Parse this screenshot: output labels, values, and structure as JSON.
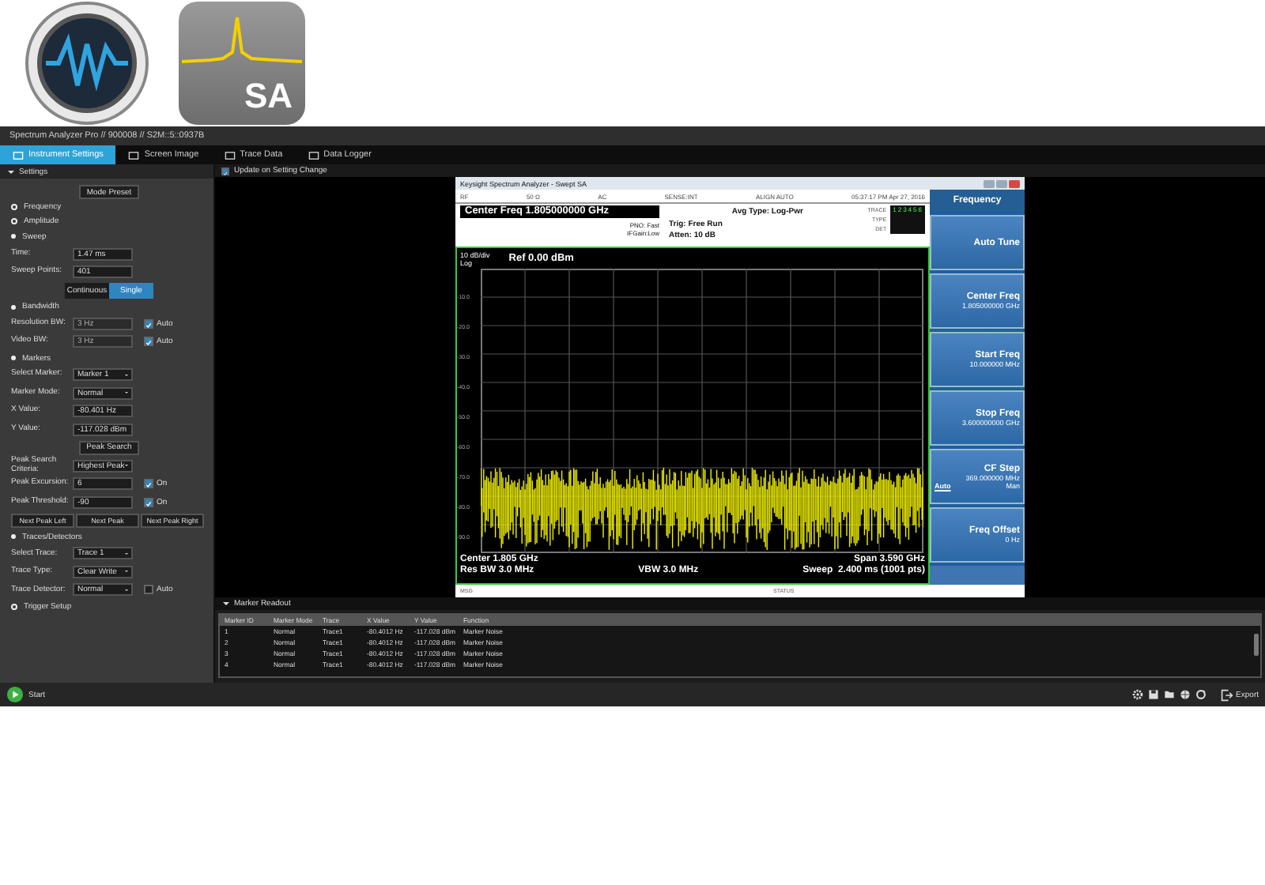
{
  "launcher": {
    "sa_label": "SA"
  },
  "window": {
    "title": "Spectrum Analyzer Pro // 900008 // S2M::5::0937B"
  },
  "tabs": [
    {
      "label": "Instrument Settings",
      "selected": true
    },
    {
      "label": "Screen Image",
      "selected": false
    },
    {
      "label": "Trace Data",
      "selected": false
    },
    {
      "label": "Data Logger",
      "selected": false
    }
  ],
  "settings": {
    "title": "Settings",
    "expanded": true,
    "preset_button": "Mode Preset",
    "sections": [
      {
        "title": "Frequency",
        "expanded": false
      },
      {
        "title": "Amplitude",
        "expanded": false
      },
      {
        "title": "Sweep",
        "expanded": true,
        "rows": [
          {
            "kind": "field",
            "label": "Time:",
            "value": "1.47 ms",
            "disabled": false
          },
          {
            "kind": "field",
            "label": "Sweep Points:",
            "value": "401",
            "disabled": false
          },
          {
            "kind": "segmented",
            "options": [
              {
                "label": "Continuous",
                "selected": false
              },
              {
                "label": "Single",
                "selected": true
              }
            ]
          }
        ]
      },
      {
        "title": "Bandwidth",
        "expanded": true,
        "rows": [
          {
            "kind": "field",
            "label": "Resolution BW:",
            "value": "3 Hz",
            "disabled": true,
            "check": {
              "label": "Auto",
              "checked": true
            }
          },
          {
            "kind": "field",
            "label": "Video BW:",
            "value": "3 Hz",
            "disabled": true,
            "check": {
              "label": "Auto",
              "checked": true
            }
          }
        ]
      },
      {
        "title": "Markers",
        "expanded": true,
        "rows": [
          {
            "kind": "dropdown",
            "label": "Select Marker:",
            "value": "Marker 1"
          },
          {
            "kind": "dropdown",
            "label": "Marker Mode:",
            "value": "Normal"
          },
          {
            "kind": "field",
            "label": "X Value:",
            "value": "-80.401 Hz",
            "disabled": false
          },
          {
            "kind": "field",
            "label": "Y Value:",
            "value": "-117.028 dBm",
            "disabled": false
          },
          {
            "kind": "button",
            "label": "Peak Search"
          },
          {
            "kind": "dropdown",
            "label": "Peak Search Criteria:",
            "value": "Highest Peak"
          },
          {
            "kind": "field",
            "label": "Peak Excursion:",
            "value": "6",
            "disabled": false,
            "check": {
              "label": "On",
              "checked": true
            }
          },
          {
            "kind": "field",
            "label": "Peak Threshold:",
            "value": "-90",
            "disabled": false,
            "check": {
              "label": "On",
              "checked": true
            }
          },
          {
            "kind": "buttons",
            "buttons": [
              "Next Peak Left",
              "Next Peak",
              "Next Peak Right"
            ]
          }
        ]
      },
      {
        "title": "Traces/Detectors",
        "expanded": true,
        "rows": [
          {
            "kind": "dropdown",
            "label": "Select Trace:",
            "value": "Trace 1"
          },
          {
            "kind": "dropdown",
            "label": "Trace Type:",
            "value": "Clear Write"
          },
          {
            "kind": "dropdown",
            "label": "Trace Detector:",
            "value": "Normal",
            "check": {
              "label": "Auto",
              "checked": false
            }
          }
        ]
      },
      {
        "title": "Trigger Setup",
        "expanded": false
      }
    ]
  },
  "update_option": {
    "label": "Update on Setting Change",
    "checked": true
  },
  "analyzer": {
    "title": "Keysight Spectrum Analyzer - Swept SA",
    "status_row": [
      "RF",
      "50 Ω",
      "AC",
      "SENSE:INT",
      "ALIGN AUTO",
      "05:37:17 PM Apr 27, 2016"
    ],
    "center_freq": "Center Freq 1.805000000 GHz",
    "pno": "PNO: Fast",
    "if_gain": "IFGain:Low",
    "trig": "Trig: Free Run",
    "atten": "Atten: 10 dB",
    "avg_type": "Avg Type: Log-Pwr",
    "trace_panel": {
      "labels": [
        "TRACE",
        "TYPE",
        "DET"
      ],
      "trace_numbers": [
        "1",
        "2",
        "3",
        "4",
        "5",
        "6"
      ]
    },
    "scale": "10 dB/div",
    "ref": "Ref 0.00 dBm",
    "log": "Log",
    "y_labels": [
      "-10.0",
      "-20.0",
      "-30.0",
      "-40.0",
      "-50.0",
      "-60.0",
      "-70.0",
      "-80.0",
      "-90.0"
    ],
    "footer": {
      "center": "Center 1.805 GHz",
      "span": "Span 3.590 GHz",
      "res_bw": "Res BW 3.0 MHz",
      "vbw": "VBW 3.0 MHz",
      "sweep": "Sweep  2.400 ms (1001 pts)"
    },
    "msg_bar": [
      "MSG",
      "STATUS"
    ],
    "softkeys": {
      "menu": "Frequency",
      "keys": [
        {
          "label": "Auto Tune"
        },
        {
          "label": "Center Freq",
          "value": "1.805000000 GHz"
        },
        {
          "label": "Start Freq",
          "value": "10.000000 MHz"
        },
        {
          "label": "Stop Freq",
          "value": "3.600000000 GHz"
        },
        {
          "label": "CF Step",
          "value": "369.000000 MHz",
          "modes": [
            {
              "label": "Auto",
              "selected": true
            },
            {
              "label": "Man",
              "selected": false
            }
          ]
        },
        {
          "label": "Freq Offset",
          "value": "0 Hz"
        }
      ]
    }
  },
  "marker_readout": {
    "title": "Marker Readout",
    "expanded": true,
    "columns": [
      "Marker ID",
      "Marker Mode",
      "Trace",
      "X Value",
      "Y Value",
      "Function"
    ],
    "rows": [
      [
        "1",
        "Normal",
        "Trace1",
        "-80.4012 Hz",
        "-117.028 dBm",
        "Marker Noise"
      ],
      [
        "2",
        "Normal",
        "Trace1",
        "-80.4012 Hz",
        "-117.028 dBm",
        "Marker Noise"
      ],
      [
        "3",
        "Normal",
        "Trace1",
        "-80.4012 Hz",
        "-117.028 dBm",
        "Marker Noise"
      ],
      [
        "4",
        "Normal",
        "Trace1",
        "-80.4012 Hz",
        "-117.028 dBm",
        "Marker Noise"
      ]
    ]
  },
  "bottom_bar": {
    "start_label": "Start",
    "export_label": "Export"
  }
}
